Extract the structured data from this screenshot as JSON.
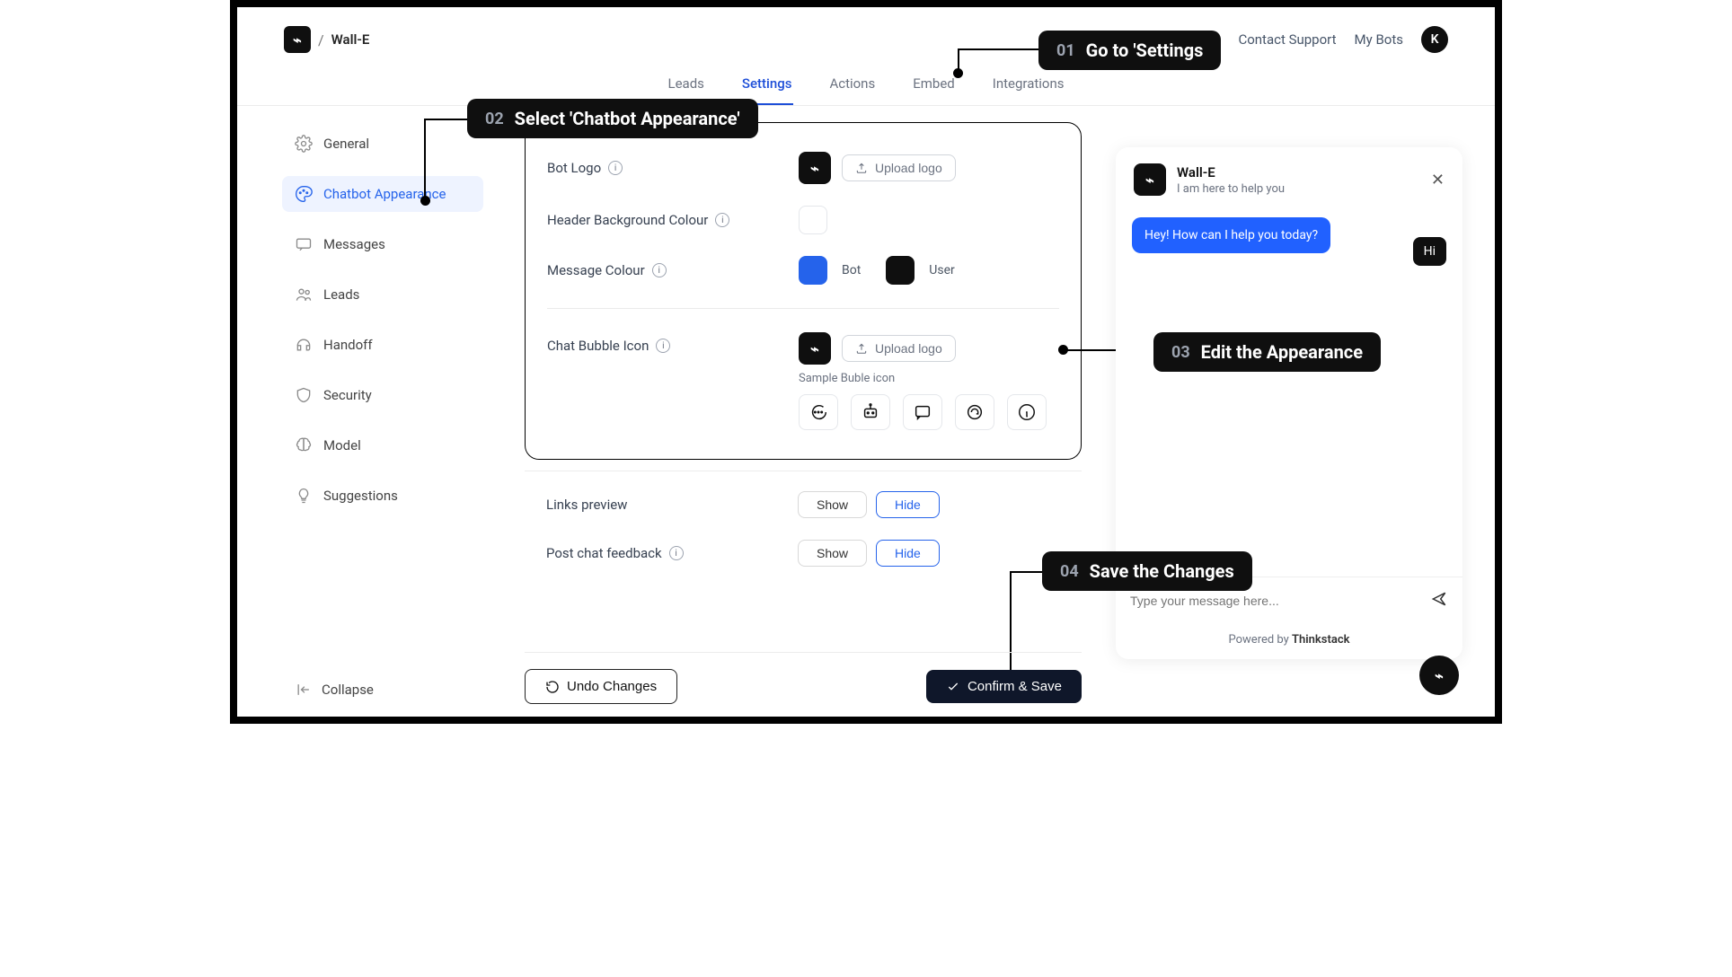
{
  "header": {
    "botName": "Wall-E",
    "links": {
      "support": "Contact Support",
      "mybots": "My Bots"
    },
    "avatarInitial": "K"
  },
  "tabs": {
    "items": [
      "Leads",
      "Settings",
      "Actions",
      "Embed",
      "Integrations"
    ],
    "activeIndex": 1
  },
  "sidebar": {
    "items": [
      "General",
      "Chatbot Appearance",
      "Messages",
      "Leads",
      "Handoff",
      "Security",
      "Model",
      "Suggestions"
    ],
    "activeIndex": 1,
    "collapse": "Collapse"
  },
  "panel": {
    "botLogo": "Bot Logo",
    "uploadLabel": "Upload logo",
    "headerBg": "Header Background Colour",
    "messageColour": "Message Colour",
    "botLabel": "Bot",
    "userLabel": "User",
    "chatBubbleIcon": "Chat Bubble Icon",
    "sampleLabel": "Sample Buble icon",
    "colors": {
      "bot": "#2563eb",
      "user": "#0f0f0f",
      "headerBg": "#ffffff"
    }
  },
  "lower": {
    "linksPreview": {
      "label": "Links preview",
      "show": "Show",
      "hide": "Hide",
      "value": "Hide"
    },
    "postChat": {
      "label": "Post chat feedback",
      "show": "Show",
      "hide": "Hide",
      "value": "Hide"
    }
  },
  "actions": {
    "undo": "Undo Changes",
    "confirm": "Confirm & Save"
  },
  "preview": {
    "title": "Wall-E",
    "subtitle": "I am here to help you",
    "botMsg": "Hey! How can I help you today?",
    "userMsg": "Hi",
    "placeholder": "Type your message here...",
    "poweredPrefix": "Powered by ",
    "poweredBrand": "Thinkstack"
  },
  "callouts": {
    "c1": {
      "num": "01",
      "text": "Go to 'Settings"
    },
    "c2": {
      "num": "02",
      "text": "Select 'Chatbot Appearance'"
    },
    "c3": {
      "num": "03",
      "text": "Edit the Appearance"
    },
    "c4": {
      "num": "04",
      "text": "Save the Changes"
    }
  }
}
